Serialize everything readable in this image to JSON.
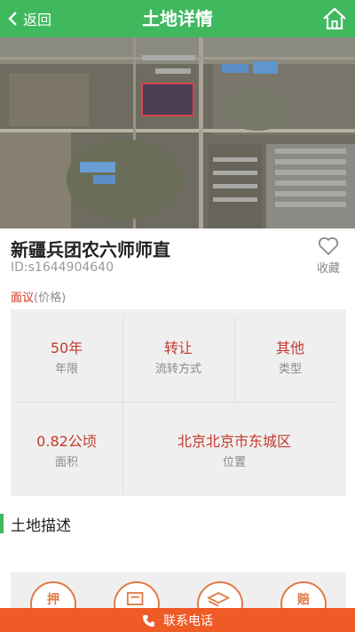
{
  "header": {
    "back_label": "返回",
    "title": "土地详情"
  },
  "land": {
    "name": "新疆兵团农六师师直",
    "id": "ID:s1644904640",
    "favorite_label": "收藏",
    "price_main": "面议",
    "price_hint": "(价格)"
  },
  "details": [
    {
      "value": "50年",
      "key": "年限"
    },
    {
      "value": "转让",
      "key": "流转方式"
    },
    {
      "value": "其他",
      "key": "类型"
    },
    {
      "value": "0.82公顷",
      "key": "面积"
    },
    {
      "value": "北京北京市东城区",
      "key": "位置"
    }
  ],
  "section": {
    "title": "土地描述"
  },
  "feature_icons": [
    "押",
    "",
    "",
    "赔"
  ],
  "contact": {
    "label": "联系电话"
  },
  "colors": {
    "brand_green": "#3fb85e",
    "accent_red": "#c4392d",
    "call_orange": "#ef5b26"
  }
}
